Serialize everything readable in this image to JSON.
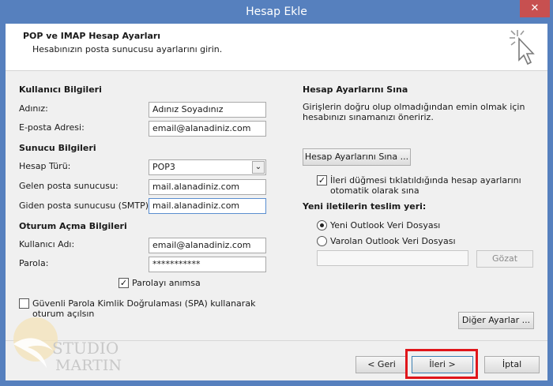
{
  "window": {
    "title": "Hesap Ekle",
    "close_symbol": "✕"
  },
  "header": {
    "title": "POP ve IMAP Hesap Ayarları",
    "subtitle": "Hesabınızın posta sunucusu ayarlarını girin."
  },
  "user_info": {
    "section": "Kullanıcı Bilgileri",
    "name_label": "Adınız:",
    "name_value": "Adınız Soyadınız",
    "email_label": "E-posta Adresi:",
    "email_value": "email@alanadiniz.com"
  },
  "server_info": {
    "section": "Sunucu Bilgileri",
    "type_label": "Hesap Türü:",
    "type_value": "POP3",
    "incoming_label": "Gelen posta sunucusu:",
    "incoming_value": "mail.alanadiniz.com",
    "outgoing_label": "Giden posta sunucusu (SMTP):",
    "outgoing_value": "mail.alanadiniz.com"
  },
  "login_info": {
    "section": "Oturum Açma Bilgileri",
    "username_label": "Kullanıcı Adı:",
    "username_value": "email@alanadiniz.com",
    "password_label": "Parola:",
    "password_value": "***********",
    "remember_label": "Parolayı anımsa",
    "remember_checked": true,
    "spa_label_line1": "Güvenli Parola Kimlik Doğrulaması (SPA) kullanarak",
    "spa_label_line2": "oturum açılsın",
    "spa_checked": false
  },
  "test": {
    "section": "Hesap Ayarlarını Sına",
    "desc_line1": "Girişlerin doğru olup olmadığından emin olmak için",
    "desc_line2": "hesabınızı sınamanızı öneririz.",
    "test_button": "Hesap Ayarlarını Sına ...",
    "auto_label_line1": "İleri düğmesi tıklatıldığında hesap ayarlarını",
    "auto_label_line2": "otomatik olarak sına",
    "auto_checked": true
  },
  "delivery": {
    "section": "Yeni iletilerin teslim yeri:",
    "option_new": "Yeni Outlook Veri Dosyası",
    "option_existing": "Varolan Outlook Veri Dosyası",
    "selected": "new",
    "path_value": "",
    "browse_button": "Gözat"
  },
  "buttons": {
    "more_settings": "Diğer Ayarlar ...",
    "back": "< Geri",
    "next": "İleri >",
    "cancel": "İptal"
  },
  "watermark": {
    "line1": "STUDIO",
    "line2": "MARTIN"
  },
  "colors": {
    "titlebar": "#5680be",
    "highlight": "#e0161b",
    "close": "#c75050"
  },
  "icons": {
    "check": "✓",
    "dropdown": "⌄"
  }
}
